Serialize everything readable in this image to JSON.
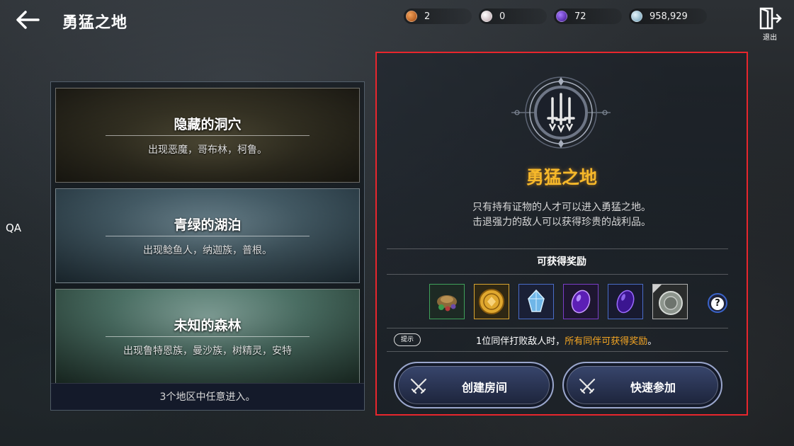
{
  "header": {
    "title": "勇猛之地",
    "exit_label": "退出"
  },
  "currencies": [
    {
      "icon": "copper-coin-icon",
      "value": "2",
      "color": "#d9731f"
    },
    {
      "icon": "pearl-icon",
      "value": "0",
      "color": "#e8d8dc"
    },
    {
      "icon": "purple-gem-icon",
      "value": "72",
      "color": "#6b2bd6"
    },
    {
      "icon": "silver-coin-icon",
      "value": "958,929",
      "color": "#9cc8e0"
    }
  ],
  "side_label": "QA",
  "regions": [
    {
      "name": "隐藏的洞穴",
      "desc": "出现恶魔，哥布林，柯鲁。"
    },
    {
      "name": "青绿的湖泊",
      "desc": "出现鲶鱼人，纳迦族，普根。"
    },
    {
      "name": "未知的森林",
      "desc": "出现鲁特恩族，曼沙族，树精灵，安特"
    }
  ],
  "regions_footer": "3个地区中任意进入。",
  "detail": {
    "title": "勇猛之地",
    "desc_line1": "只有持有证物的人才可以进入勇猛之地。",
    "desc_line2": "击退强力的敌人可以获得珍贵的战利品。",
    "rewards_title": "可获得奖励",
    "rewards": [
      {
        "icon": "gear-pile-icon",
        "border": "#3fa15a"
      },
      {
        "icon": "gold-coin-icon",
        "border": "#d9a531"
      },
      {
        "icon": "blue-crystal-icon",
        "border": "#4a6cc8"
      },
      {
        "icon": "purple-stone-icon",
        "border": "#7a3ec8"
      },
      {
        "icon": "dark-purple-stone-icon",
        "border": "#4a6cc8"
      },
      {
        "icon": "silver-medal-icon",
        "border": "#b0b0b0"
      }
    ],
    "tip_badge": "提示",
    "tip_prefix": "1位同伴打败敌人时，",
    "tip_highlight": "所有同伴可获得奖励",
    "tip_suffix": "。",
    "create_room": "创建房间",
    "quick_join": "快速参加"
  }
}
